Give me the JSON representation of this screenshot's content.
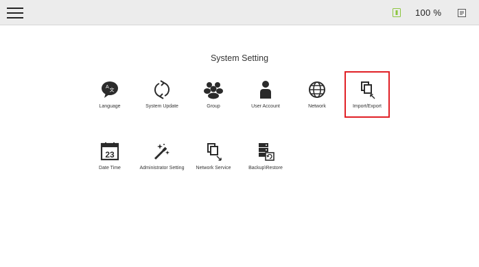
{
  "topbar": {
    "zoom": "100 %",
    "icons": [
      "menu-icon",
      "battery-icon",
      "display-icon"
    ]
  },
  "page": {
    "title": "System Setting"
  },
  "settings": {
    "row1": [
      {
        "label": "Language",
        "icon": "language-icon"
      },
      {
        "label": "System Update",
        "icon": "sync-icon"
      },
      {
        "label": "Group",
        "icon": "group-icon"
      },
      {
        "label": "User Account",
        "icon": "user-icon"
      },
      {
        "label": "Network",
        "icon": "globe-icon"
      },
      {
        "label": "Import/Export",
        "icon": "import-export-icon"
      }
    ],
    "row2": [
      {
        "label": "Date Time",
        "icon": "calendar-icon",
        "day": "23"
      },
      {
        "label": "Administrator Setting",
        "icon": "magic-wand-icon"
      },
      {
        "label": "Network Service",
        "icon": "copy-arrow-icon"
      },
      {
        "label": "Backup\\Restore",
        "icon": "server-backup-icon"
      }
    ],
    "selected": "Import/Export"
  },
  "colors": {
    "topbar_bg": "#ececec",
    "selection_border": "#e01e24",
    "icon": "#2b2b2b",
    "battery": "#8cc63e"
  }
}
